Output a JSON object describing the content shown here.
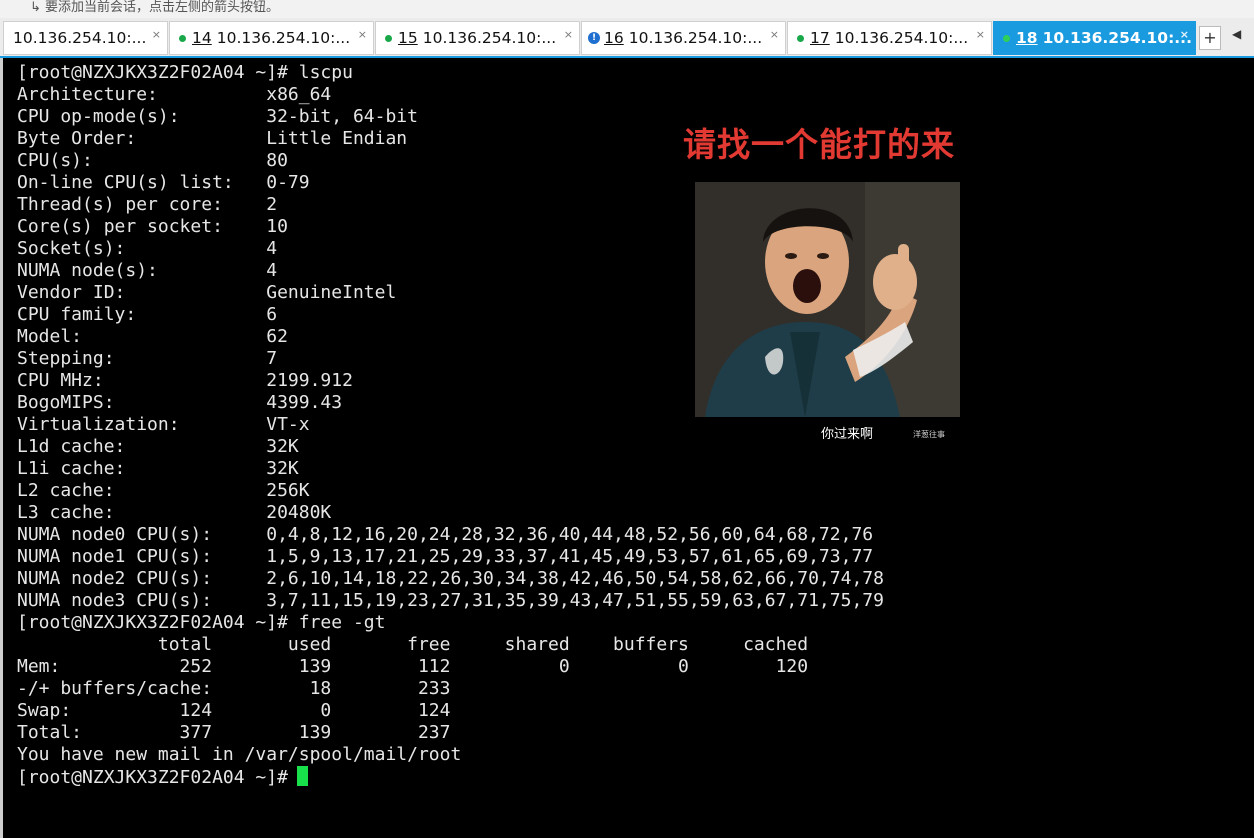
{
  "topbar": {
    "message": "↳ 要添加当前会话，点击左侧的箭头按钮。"
  },
  "tabs": [
    {
      "number": "",
      "label": "10.136.254.10:...",
      "status": "none",
      "active": false
    },
    {
      "number": "14",
      "label": "10.136.254.10:...",
      "status": "ok",
      "active": false
    },
    {
      "number": "15",
      "label": "10.136.254.10:...",
      "status": "ok",
      "active": false
    },
    {
      "number": "16",
      "label": "10.136.254.10:...",
      "status": "warning",
      "active": false
    },
    {
      "number": "17",
      "label": "10.136.254.10:...",
      "status": "ok",
      "active": false
    },
    {
      "number": "18",
      "label": "10.136.254.10:...",
      "status": "ok",
      "active": true
    }
  ],
  "tab_close": "×",
  "tab_warning": "!",
  "new_tab_label": "+",
  "tab_scroll_label": "◀",
  "terminal": {
    "lines": [
      "[root@NZXJKX3Z2F02A04 ~]# lscpu",
      "Architecture:          x86_64",
      "CPU op-mode(s):        32-bit, 64-bit",
      "Byte Order:            Little Endian",
      "CPU(s):                80",
      "On-line CPU(s) list:   0-79",
      "Thread(s) per core:    2",
      "Core(s) per socket:    10",
      "Socket(s):             4",
      "NUMA node(s):          4",
      "Vendor ID:             GenuineIntel",
      "CPU family:            6",
      "Model:                 62",
      "Stepping:              7",
      "CPU MHz:               2199.912",
      "BogoMIPS:              4399.43",
      "Virtualization:        VT-x",
      "L1d cache:             32K",
      "L1i cache:             32K",
      "L2 cache:              256K",
      "L3 cache:              20480K",
      "NUMA node0 CPU(s):     0,4,8,12,16,20,24,28,32,36,40,44,48,52,56,60,64,68,72,76",
      "NUMA node1 CPU(s):     1,5,9,13,17,21,25,29,33,37,41,45,49,53,57,61,65,69,73,77",
      "NUMA node2 CPU(s):     2,6,10,14,18,22,26,30,34,38,42,46,50,54,58,62,66,70,74,78",
      "NUMA node3 CPU(s):     3,7,11,15,19,23,27,31,35,39,43,47,51,55,59,63,67,71,75,79",
      "[root@NZXJKX3Z2F02A04 ~]# free -gt",
      "             total       used       free     shared    buffers     cached",
      "Mem:           252        139        112          0          0        120",
      "-/+ buffers/cache:         18        233",
      "Swap:          124          0        124",
      "Total:         377        139        237",
      "You have new mail in /var/spool/mail/root"
    ],
    "prompt": "[root@NZXJKX3Z2F02A04 ~]# "
  },
  "meme": {
    "caption": "请找一个能打的来",
    "subtitle": "你过来啊",
    "watermark": "洋葱往事"
  },
  "colors": {
    "terminal_bg": "#000000",
    "terminal_fg": "#e6e6e6",
    "cursor": "#18e04a",
    "active_tab": "#1a9be0",
    "status_ok": "#18a84a",
    "status_warning": "#1f6fd1",
    "caption_red": "#e23a32"
  }
}
